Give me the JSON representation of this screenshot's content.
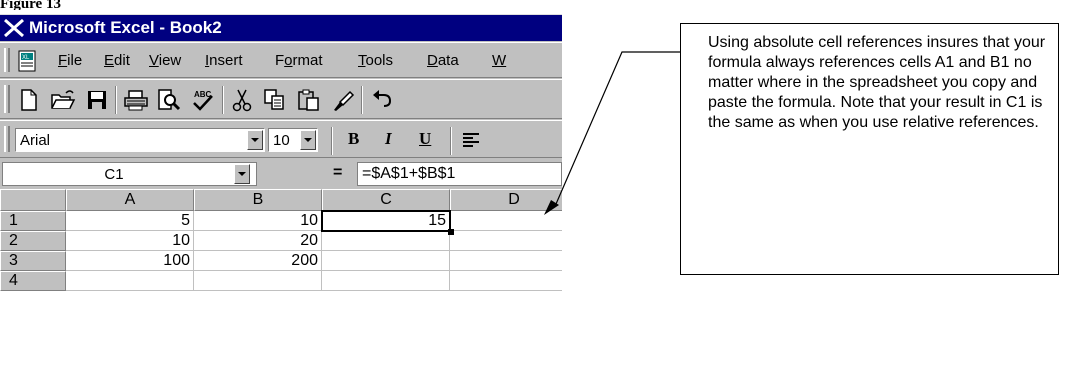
{
  "figure_label": "Figure 13",
  "window": {
    "title": "Microsoft Excel - Book2"
  },
  "menu": [
    {
      "pre": "",
      "ul": "F",
      "post": "ile"
    },
    {
      "pre": "",
      "ul": "E",
      "post": "dit"
    },
    {
      "pre": "",
      "ul": "V",
      "post": "iew"
    },
    {
      "pre": "",
      "ul": "I",
      "post": "nsert"
    },
    {
      "pre": "F",
      "ul": "o",
      "post": "rmat"
    },
    {
      "pre": "",
      "ul": "T",
      "post": "ools"
    },
    {
      "pre": "",
      "ul": "D",
      "post": "ata"
    },
    {
      "pre": "",
      "ul": "W",
      "post": ""
    }
  ],
  "toolbar_icons": [
    "new-icon",
    "open-icon",
    "save-icon",
    "print-icon",
    "print-preview-icon",
    "spelling-icon",
    "cut-icon",
    "copy-icon",
    "paste-icon",
    "format-painter-icon",
    "undo-icon"
  ],
  "format_bar": {
    "font": "Arial",
    "size": "10",
    "bold": "B",
    "italic": "I",
    "underline": "U"
  },
  "formula_bar": {
    "name_box": "C1",
    "equals": "=",
    "formula": "=$A$1+$B$1"
  },
  "grid": {
    "columns": [
      "A",
      "B",
      "C",
      "D"
    ],
    "rows": [
      {
        "num": "1",
        "cells": [
          "5",
          "10",
          "15",
          ""
        ]
      },
      {
        "num": "2",
        "cells": [
          "10",
          "20",
          "",
          ""
        ]
      },
      {
        "num": "3",
        "cells": [
          "100",
          "200",
          "",
          ""
        ]
      },
      {
        "num": "4",
        "cells": [
          "",
          "",
          "",
          ""
        ]
      }
    ],
    "active_cell": "C1"
  },
  "callout": {
    "text": "Using absolute cell references insures that your formula always references cells A1 and B1 no matter where in the spreadsheet you copy and paste the formula. Note that your result in C1 is the same as when you use relative references."
  },
  "colors": {
    "title_bar": "#000080",
    "chrome": "#c0c0c0"
  }
}
